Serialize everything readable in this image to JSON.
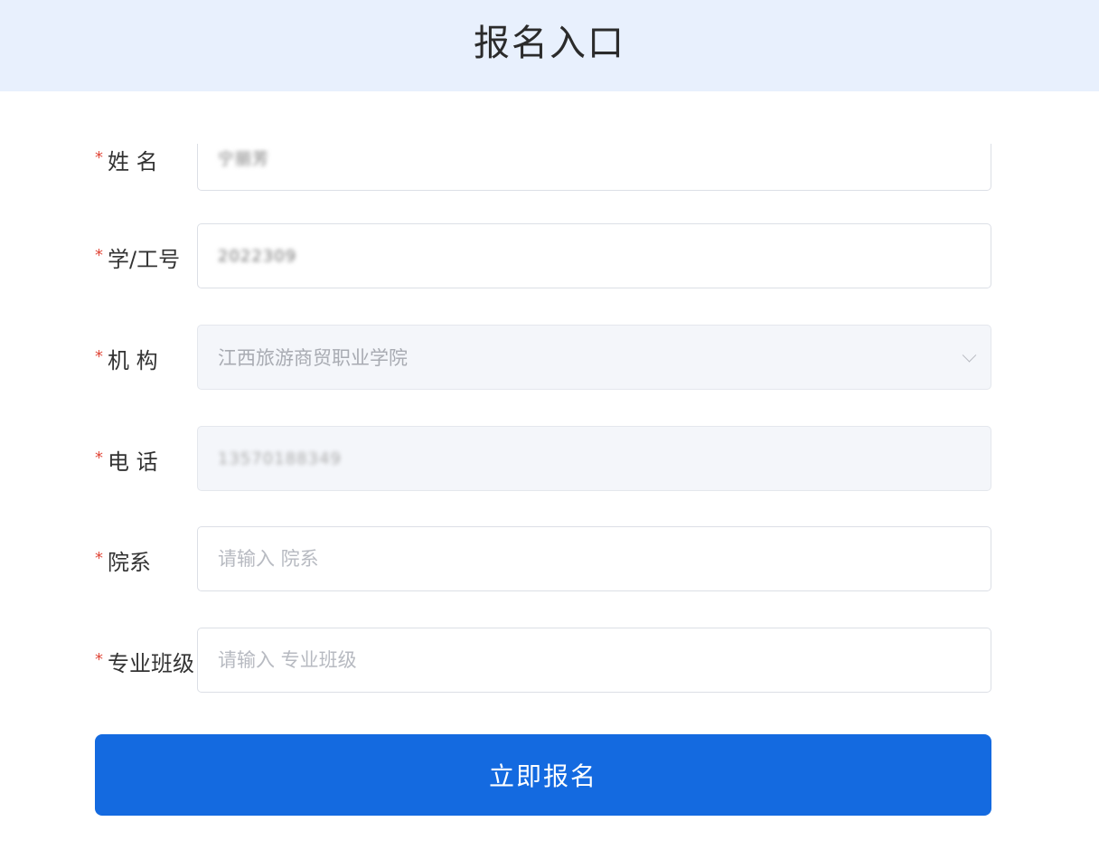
{
  "header": {
    "title": "报名入口"
  },
  "form": {
    "required_mark": "*",
    "fields": [
      {
        "label": "姓 名",
        "value": "宁丽芳",
        "placeholder": ""
      },
      {
        "label": "学/工号",
        "value": "2022309",
        "placeholder": ""
      },
      {
        "label": "机 构",
        "value": "江西旅游商贸职业学院",
        "placeholder": ""
      },
      {
        "label": "电 话",
        "value": "13570188349",
        "placeholder": ""
      },
      {
        "label": "院系",
        "value": "",
        "placeholder": "请输入 院系"
      },
      {
        "label": "专业班级",
        "value": "",
        "placeholder": "请输入 专业班级"
      }
    ],
    "submit_label": "立即报名"
  },
  "icons": {
    "dropdown": "chevron-down-icon"
  }
}
